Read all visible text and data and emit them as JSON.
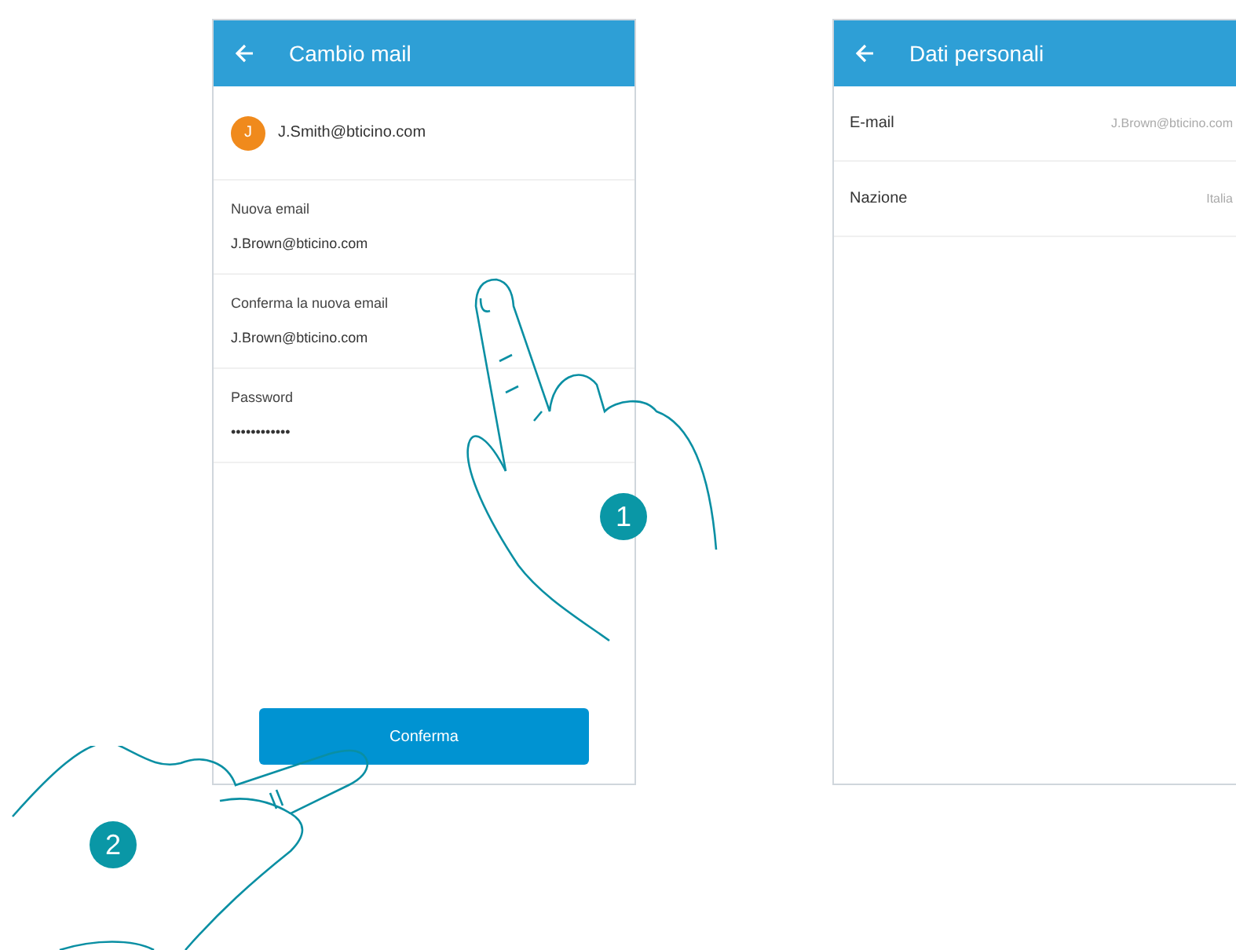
{
  "left_screen": {
    "title": "Cambio mail",
    "account": {
      "initial": "J",
      "email": "J.Smith@bticino.com"
    },
    "fields": [
      {
        "label": "Nuova email",
        "value": "J.Brown@bticino.com"
      },
      {
        "label": "Conferma la nuova email",
        "value": "J.Brown@bticino.com"
      },
      {
        "label": "Password",
        "value": "••••••••••••"
      }
    ],
    "button": "Conferma"
  },
  "right_screen": {
    "title": "Dati personali",
    "rows": [
      {
        "label": "E-mail",
        "value": "J.Brown@bticino.com"
      },
      {
        "label": "Nazione",
        "value": "Italia"
      }
    ]
  },
  "steps": [
    "1",
    "2"
  ]
}
